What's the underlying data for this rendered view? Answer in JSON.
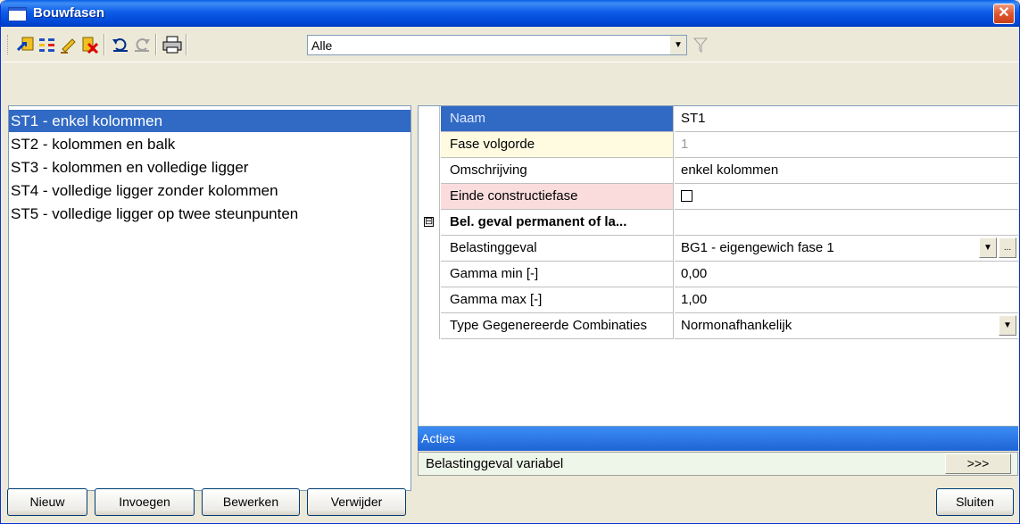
{
  "window": {
    "title": "Bouwfasen"
  },
  "toolbar": {
    "filter_value": "Alle",
    "icons": [
      "add-icon",
      "insert-icon",
      "edit-icon",
      "delete-icon",
      "undo-icon",
      "redo-icon",
      "print-icon",
      "filter-icon"
    ]
  },
  "phases": [
    {
      "label": "ST1 - enkel kolommen",
      "selected": true
    },
    {
      "label": "ST2 - kolommen en balk",
      "selected": false
    },
    {
      "label": "ST3 - kolommen en volledige ligger",
      "selected": false
    },
    {
      "label": "ST4 - volledige ligger zonder kolommen",
      "selected": false
    },
    {
      "label": "ST5 - volledige ligger op twee steunpunten",
      "selected": false
    }
  ],
  "properties": [
    {
      "label": "Naam",
      "value": "ST1"
    },
    {
      "label": "Fase volgorde",
      "value": "1"
    },
    {
      "label": "Omschrijving",
      "value": "enkel kolommen"
    },
    {
      "label": "Einde constructiefase",
      "value": ""
    },
    {
      "label": "Bel. geval permanent of la...",
      "value": "",
      "group_toggle": "⊟"
    },
    {
      "label": "Belastinggeval",
      "value": "BG1 - eigengewich fase 1",
      "button": "..."
    },
    {
      "label": "Gamma min [-]",
      "value": "0,00"
    },
    {
      "label": "Gamma max [-]",
      "value": "1,00"
    },
    {
      "label": "Type Gegenereerde Combinaties",
      "value": "Normonafhankelijk"
    }
  ],
  "actions": {
    "header": "Acties",
    "item": "Belastinggeval variabel",
    "button": ">>>"
  },
  "buttons": {
    "new": "Nieuw",
    "insert": "Invoegen",
    "edit": "Bewerken",
    "delete": "Verwijder",
    "close": "Sluiten"
  },
  "colors": {
    "selection": "#316ac5",
    "titlebar": "#0a5fe6",
    "readonly_label": "#fffbe1",
    "required_label": "#fadcdc"
  }
}
